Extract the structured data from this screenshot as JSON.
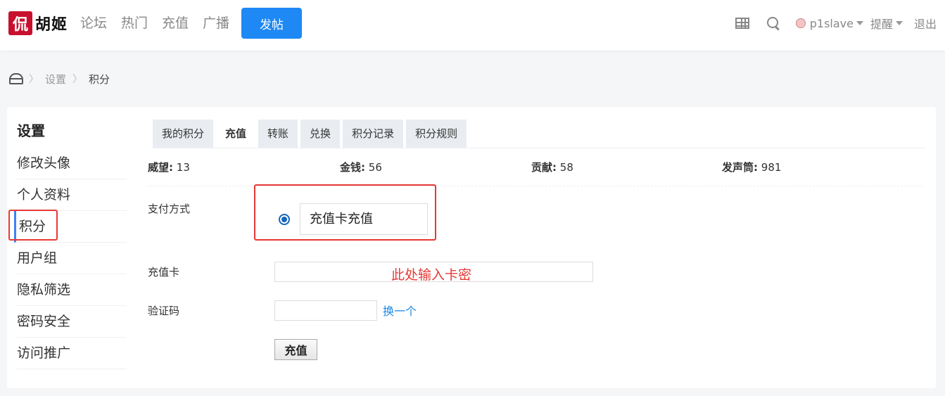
{
  "header": {
    "logo_seal": "侃",
    "logo_text": "胡姬",
    "nav": [
      "论坛",
      "热门",
      "充值",
      "广播"
    ],
    "post_button": "发帖",
    "username": "p1slave",
    "remind": "提醒",
    "logout": "退出"
  },
  "breadcrumb": {
    "items": [
      "设置",
      "积分"
    ]
  },
  "sidebar": {
    "title": "设置",
    "items": [
      "修改头像",
      "个人资料",
      "积分",
      "用户组",
      "隐私筛选",
      "密码安全",
      "访问推广"
    ],
    "active_index": 2
  },
  "tabs": {
    "items": [
      "我的积分",
      "充值",
      "转账",
      "兑换",
      "积分记录",
      "积分规则"
    ],
    "active_index": 1
  },
  "stats": [
    {
      "label": "威望:",
      "value": "13"
    },
    {
      "label": "金钱:",
      "value": "56"
    },
    {
      "label": "贡献:",
      "value": "58"
    },
    {
      "label": "发声筒:",
      "value": "981"
    }
  ],
  "form": {
    "payment_label": "支付方式",
    "payment_option": "充值卡充值",
    "card_label": "充值卡",
    "card_hint": "此处输入卡密",
    "captcha_label": "验证码",
    "refresh_link": "换一个",
    "submit": "充值"
  },
  "colors": {
    "accent_blue": "#1e88f5",
    "highlight_red": "#e53935",
    "link_blue": "#1e88e5"
  }
}
